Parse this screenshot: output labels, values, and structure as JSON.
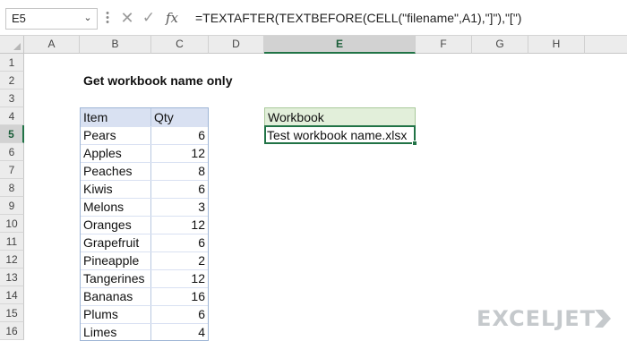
{
  "formula_bar": {
    "name_box": "E5",
    "formula": "=TEXTAFTER(TEXTBEFORE(CELL(\"filename\",A1),\"]\"),\"[\")",
    "fx_label": "fx"
  },
  "columns": [
    "A",
    "B",
    "C",
    "D",
    "E",
    "F",
    "G",
    "H"
  ],
  "rows": [
    "1",
    "2",
    "3",
    "4",
    "5",
    "6",
    "7",
    "8",
    "9",
    "10",
    "11",
    "12",
    "13",
    "14",
    "15",
    "16"
  ],
  "selected_cell": "E5",
  "title": "Get workbook name only",
  "table": {
    "headers": [
      "Item",
      "Qty"
    ],
    "rows": [
      {
        "item": "Pears",
        "qty": "6"
      },
      {
        "item": "Apples",
        "qty": "12"
      },
      {
        "item": "Peaches",
        "qty": "8"
      },
      {
        "item": "Kiwis",
        "qty": "6"
      },
      {
        "item": "Melons",
        "qty": "3"
      },
      {
        "item": "Oranges",
        "qty": "12"
      },
      {
        "item": "Grapefruit",
        "qty": "6"
      },
      {
        "item": "Pineapple",
        "qty": "2"
      },
      {
        "item": "Tangerines",
        "qty": "12"
      },
      {
        "item": "Bananas",
        "qty": "16"
      },
      {
        "item": "Plums",
        "qty": "6"
      },
      {
        "item": "Limes",
        "qty": "4"
      }
    ]
  },
  "workbook": {
    "header": "Workbook",
    "value": "Test workbook name.xlsx"
  },
  "logo": "EXCELJET",
  "colors": {
    "accent": "#217346",
    "table_header": "#d9e1f2",
    "workbook_header": "#e2efda"
  }
}
